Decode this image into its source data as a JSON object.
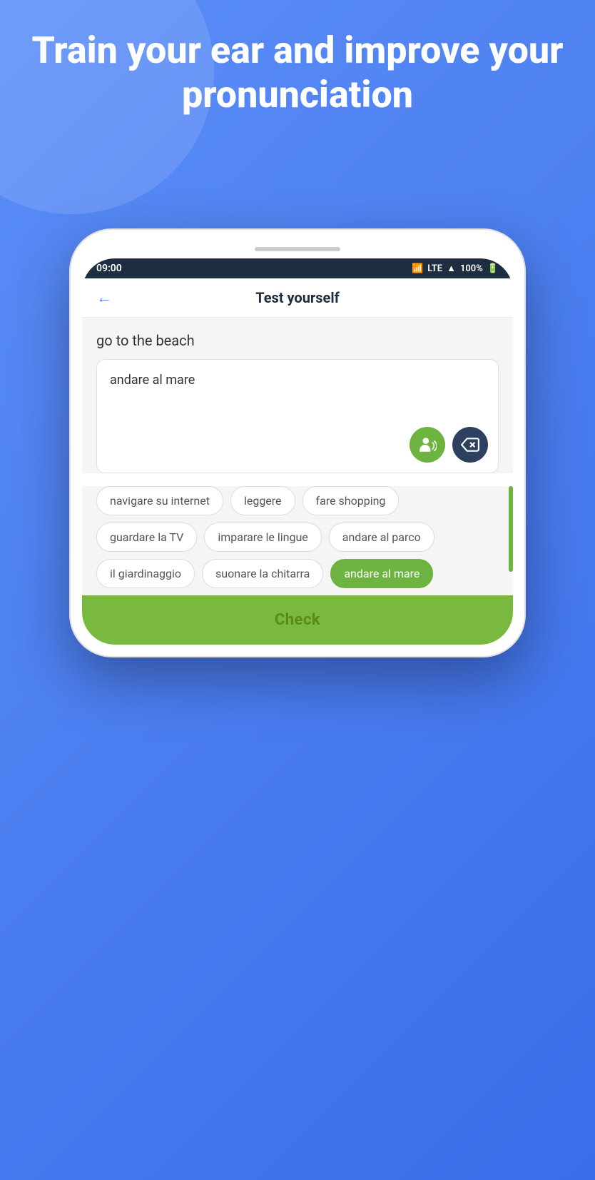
{
  "background": {
    "color": "#4a7cf7"
  },
  "hero": {
    "title": "Train your ear and improve your pronunciation"
  },
  "status_bar": {
    "time": "09:00",
    "wifi": "wifi",
    "lte": "LTE",
    "signal": "signal",
    "battery": "100%"
  },
  "header": {
    "back_label": "←",
    "title": "Test yourself"
  },
  "prompt": {
    "text": "go to the beach"
  },
  "answer_box": {
    "text": "andare al mare"
  },
  "chips": [
    {
      "label": "navigare su internet",
      "selected": false
    },
    {
      "label": "leggere",
      "selected": false
    },
    {
      "label": "fare shopping",
      "selected": false
    },
    {
      "label": "guardare la TV",
      "selected": false
    },
    {
      "label": "imparare le lingue",
      "selected": false
    },
    {
      "label": "andare al parco",
      "selected": false
    },
    {
      "label": "il giardinaggio",
      "selected": false
    },
    {
      "label": "suonare la chitarra",
      "selected": false
    },
    {
      "label": "andare al mare",
      "selected": true
    }
  ],
  "check_button": {
    "label": "Check"
  }
}
